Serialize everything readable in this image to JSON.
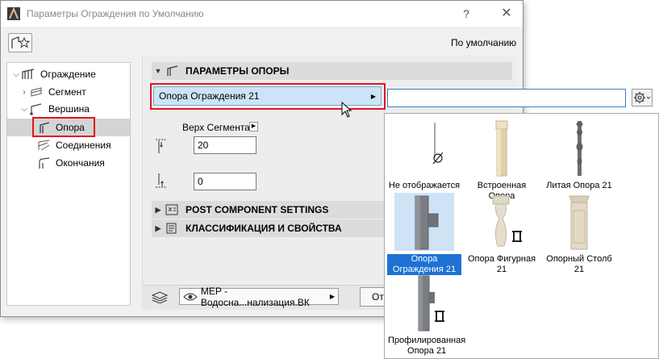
{
  "window": {
    "title": "Параметры Ограждения по Умолчанию",
    "help_label": "?",
    "close_label": "✕"
  },
  "toolbar": {
    "defaults_label": "По умолчанию"
  },
  "tree": {
    "items": [
      {
        "label": "Ограждение",
        "icon": "railing-icon",
        "expanded": true
      },
      {
        "label": "Сегмент",
        "icon": "segment-icon",
        "expanded": false
      },
      {
        "label": "Вершина",
        "icon": "node-icon",
        "expanded": true
      },
      {
        "label": "Опора",
        "icon": "post-icon",
        "selected": true
      },
      {
        "label": "Соединения",
        "icon": "connections-icon"
      },
      {
        "label": "Окончания",
        "icon": "endings-icon"
      }
    ]
  },
  "panel": {
    "post_section_title": "ПАРАМЕТРЫ ОПОРЫ",
    "selected_post": "Опора Ограждения 21",
    "top_segment_label": "Верх Сегмента",
    "top_offset_value": "20",
    "bottom_offset_value": "0",
    "post_component_title": "POST COMPONENT SETTINGS",
    "classification_title": "КЛАССИФИКАЦИЯ И СВОЙСТВА",
    "layer_value": "MEP - Водосна...нализация.ВК",
    "cut_button_label": "Отмена"
  },
  "picker": {
    "search_value": "",
    "items": [
      {
        "label": "Не отображается",
        "icon": "none-icon",
        "selected": false
      },
      {
        "label": "Встроенная Опора",
        "icon": "wood-post-icon",
        "selected": false
      },
      {
        "label": "Литая Опора 21",
        "icon": "cast-post-icon",
        "selected": false
      },
      {
        "label": "Опора Ограждения 21",
        "icon": "rail-post-icon",
        "selected": true
      },
      {
        "label": "Опора Фигурная 21",
        "icon": "baluster-icon",
        "selected": false
      },
      {
        "label": "Опорный Столб 21",
        "icon": "newel-post-icon",
        "selected": false
      },
      {
        "label": "Профилированная Опора 21",
        "icon": "profile-post-icon",
        "selected": false
      }
    ]
  },
  "colors": {
    "highlight_red": "#e0161e",
    "selection_blue": "#1e72d4",
    "row_blue": "#cce4f7",
    "wood": "#e3cfa8",
    "metal": "#7a7d82"
  }
}
